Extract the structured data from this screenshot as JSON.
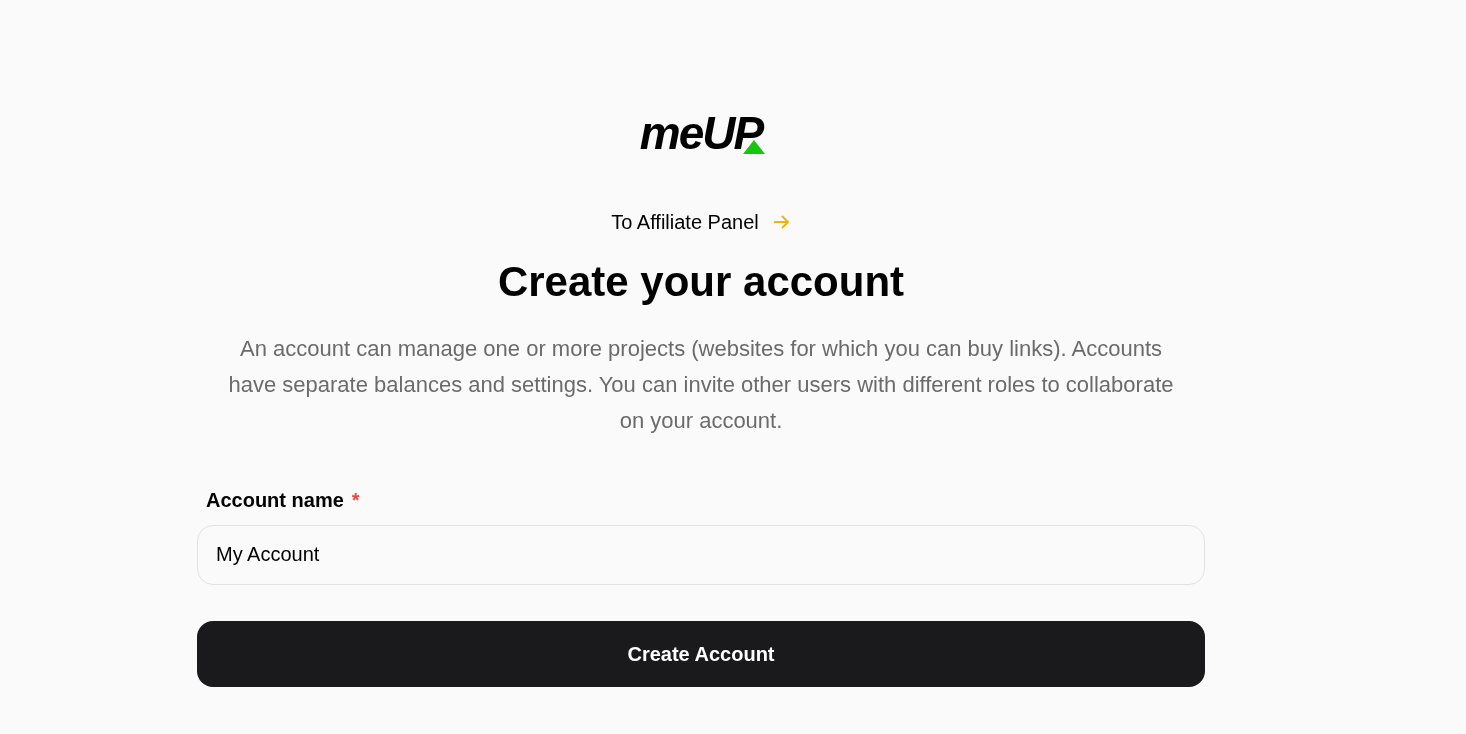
{
  "logo": {
    "text": "meUP"
  },
  "affiliate_link": {
    "label": "To Affiliate Panel"
  },
  "heading": "Create your account",
  "description": "An account can manage one or more projects (websites for which you can buy links). Accounts have separate balances and settings. You can invite other users with different roles to collaborate on your account.",
  "field": {
    "label": "Account name",
    "required_mark": "*",
    "value": "My Account"
  },
  "submit_button": {
    "label": "Create Account"
  }
}
